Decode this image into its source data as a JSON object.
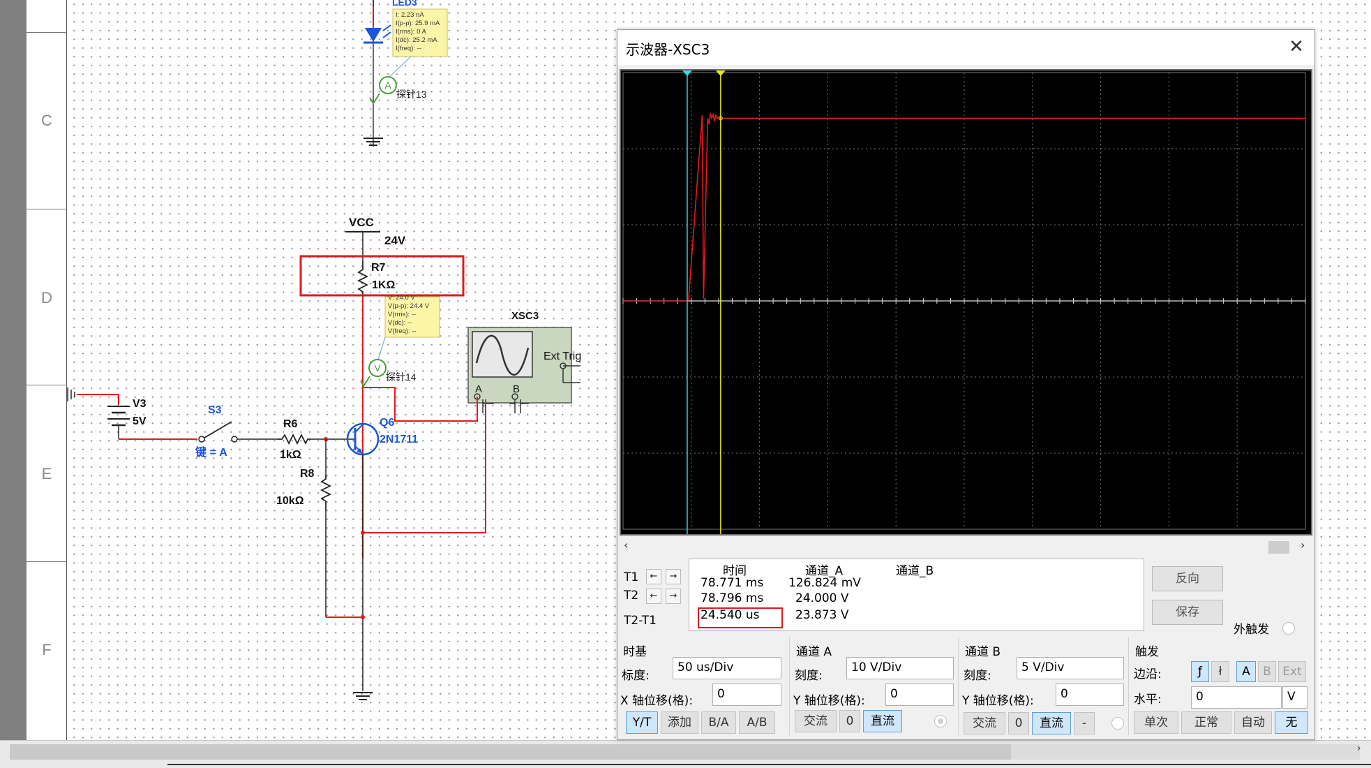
{
  "ruler": {
    "rows": [
      "C",
      "D",
      "E",
      "F"
    ]
  },
  "schematic": {
    "led_probe": {
      "lines": [
        "I: 2.23 nA",
        "I(p-p): 25.9 mA",
        "I(rms): 0 A",
        "I(dc): 25.2 mA",
        "I(freq): --"
      ],
      "probe_label": "探针13",
      "meter_symbol": "A",
      "clipped_label": "LED3"
    },
    "vcc_label": "VCC",
    "vcc_value": "24V",
    "r7_name": "R7",
    "r7_value": "1KΩ",
    "voltage_probe": {
      "lines": [
        "V: 24.0 V",
        "V(p-p): 24.4 V",
        "V(rms): --",
        "V(dc): --",
        "V(freq): --"
      ],
      "probe_label": "探针14",
      "meter_symbol": "V"
    },
    "xsc_label": "XSC3",
    "xsc_ext": "Ext Trig",
    "xsc_a": "A",
    "xsc_b": "B",
    "v3_name": "V3",
    "v3_value": "5V",
    "s3_name": "S3",
    "s3_key": "键 = A",
    "r6_name": "R6",
    "r6_value": "1kΩ",
    "q6_name": "Q6",
    "q6_model": "2N1711",
    "r8_name": "R8",
    "r8_value": "10kΩ"
  },
  "oscilloscope": {
    "title": "示波器-XSC3",
    "close_symbol": "✕",
    "cursors": {
      "t1": "T1",
      "t2": "T2",
      "t2t1": "T2-T1",
      "left_arrow": "←",
      "right_arrow": "→"
    },
    "scroll": {
      "left": "‹",
      "right": "›"
    },
    "readout": {
      "headers": [
        "时间",
        "通道_A",
        "通道_B"
      ],
      "rows": [
        {
          "time": "78.771 ms",
          "a": "126.824 mV",
          "b": ""
        },
        {
          "time": "78.796 ms",
          "a": "24.000 V",
          "b": ""
        },
        {
          "time": "24.540 us",
          "a": "23.873 V",
          "b": ""
        }
      ]
    },
    "side_buttons": {
      "reverse": "反向",
      "save": "保存",
      "ext_trigger": "外触发"
    },
    "timebase": {
      "title": "时基",
      "scale_label": "标度:",
      "scale_value": "50 us/Div",
      "xpos_label": "X 轴位移(格):",
      "xpos_value": "0",
      "buttons": [
        "Y/T",
        "添加",
        "B/A",
        "A/B"
      ]
    },
    "channel_a": {
      "title": "通道 A",
      "scale_label": "刻度:",
      "scale_value": "10  V/Div",
      "ypos_label": "Y 轴位移(格):",
      "ypos_value": "0",
      "buttons": [
        "交流",
        "0",
        "直流"
      ]
    },
    "channel_b": {
      "title": "通道 B",
      "scale_label": "刻度:",
      "scale_value": "5  V/Div",
      "ypos_label": "Y 轴位移(格):",
      "ypos_value": "0",
      "buttons": [
        "交流",
        "0",
        "直流",
        "-"
      ]
    },
    "trigger": {
      "title": "触发",
      "edge_label": "边沿:",
      "edge_rise": "ƒ",
      "edge_fall": "ł",
      "sources": [
        "A",
        "B",
        "Ext"
      ],
      "level_label": "水平:",
      "level_value": "0",
      "level_unit": "V",
      "modes": [
        "单次",
        "正常",
        "自动",
        "无"
      ]
    },
    "colors": {
      "trace_a": "#e31a1c",
      "cursor_t1": "#3ad7e6",
      "cursor_t2": "#e8e820",
      "grid": "#777777",
      "highlight": "#e0191b"
    }
  },
  "chart_data": {
    "type": "line",
    "title": "",
    "xlabel": "",
    "ylabel": "",
    "x_unit": "us",
    "x_per_div": 50,
    "x_divisions": 10,
    "xlim": [
      0,
      500
    ],
    "y_unit": "V",
    "y_per_div": 10,
    "y_divisions": 6,
    "ylim": [
      -30,
      30
    ],
    "cursors": {
      "t1": 47,
      "t2": 71.5
    },
    "series": [
      {
        "x": [
          0,
          47,
          48,
          58,
          59,
          62,
          63,
          64,
          65,
          66,
          67,
          68,
          69,
          70,
          71.5,
          500
        ],
        "y": [
          0,
          0,
          0.2,
          24.4,
          0.3,
          24.0,
          23.2,
          24.7,
          24.0,
          24.5,
          23.6,
          24.4,
          24.0,
          24.1,
          24.0,
          24.0
        ]
      }
    ]
  }
}
